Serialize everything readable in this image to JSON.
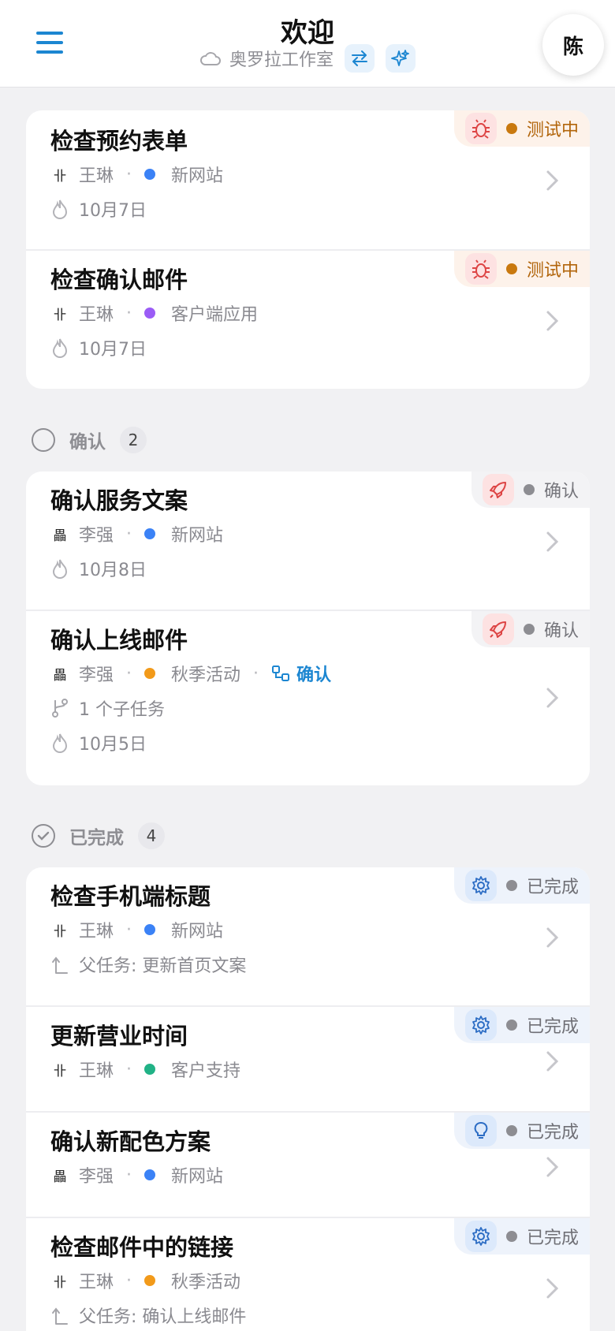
{
  "header": {
    "title": "欢迎",
    "workspace": "奥罗拉工作室",
    "avatar": "陈"
  },
  "colors": {
    "accent": "#1c86d1",
    "testing": "#c9790f",
    "blue_project": "#3b82f6",
    "purple_project": "#9b5cf6",
    "orange_project": "#f29a1a",
    "green_project": "#21b286"
  },
  "group_testing": {
    "tasks": [
      {
        "title": "检查预约表单",
        "assignee": "王琳",
        "project": "新网站",
        "date": "10月7日",
        "status": "测试中",
        "type_icon": "bug-icon"
      },
      {
        "title": "检查确认邮件",
        "assignee": "王琳",
        "project": "客户端应用",
        "date": "10月7日",
        "status": "测试中",
        "type_icon": "bug-icon"
      }
    ]
  },
  "group_confirm": {
    "label": "确认",
    "count": "2",
    "tasks": [
      {
        "title": "确认服务文案",
        "assignee": "李强",
        "project": "新网站",
        "date": "10月8日",
        "status": "确认",
        "type_icon": "rocket-icon"
      },
      {
        "title": "确认上线邮件",
        "assignee": "李强",
        "project": "秋季活动",
        "link": "确认",
        "subtasks": "1 个子任务",
        "date": "10月5日",
        "status": "确认",
        "type_icon": "rocket-icon"
      }
    ]
  },
  "group_done": {
    "label": "已完成",
    "count": "4",
    "tasks": [
      {
        "title": "检查手机端标题",
        "assignee": "王琳",
        "project": "新网站",
        "parent": "父任务: 更新首页文案",
        "status": "已完成",
        "type_icon": "gear-icon"
      },
      {
        "title": "更新营业时间",
        "assignee": "王琳",
        "project": "客户支持",
        "status": "已完成",
        "type_icon": "gear-icon"
      },
      {
        "title": "确认新配色方案",
        "assignee": "李强",
        "project": "新网站",
        "status": "已完成",
        "type_icon": "lightbulb-icon"
      },
      {
        "title": "检查邮件中的链接",
        "assignee": "王琳",
        "project": "秋季活动",
        "parent": "父任务: 确认上线邮件",
        "status": "已完成",
        "type_icon": "gear-icon"
      }
    ]
  }
}
